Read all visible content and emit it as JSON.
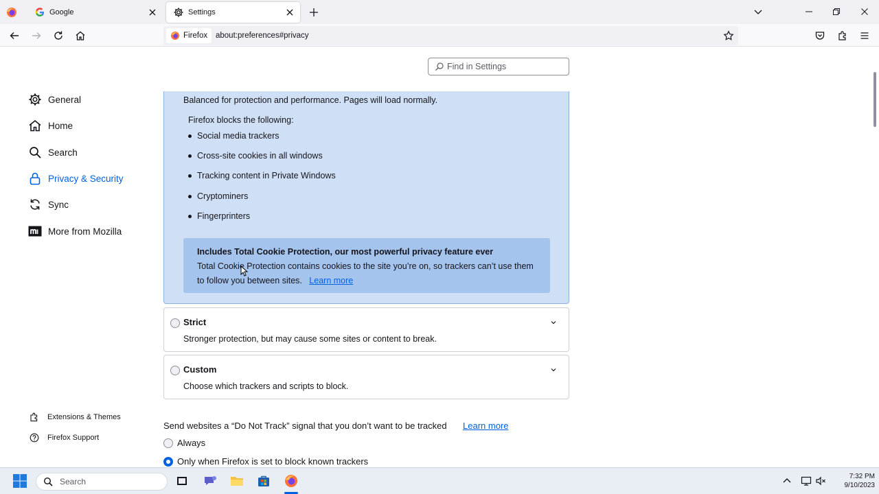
{
  "browser": {
    "tabs": [
      {
        "label": "Google",
        "favicon": "google-icon",
        "active": false
      },
      {
        "label": "Settings",
        "favicon": "gear-icon",
        "active": true
      }
    ],
    "identity_label": "Firefox",
    "url": "about:preferences#privacy"
  },
  "sidebar": {
    "categories": [
      {
        "label": "General",
        "icon": "gear-icon",
        "selected": false
      },
      {
        "label": "Home",
        "icon": "home-icon",
        "selected": false
      },
      {
        "label": "Search",
        "icon": "search-icon",
        "selected": false
      },
      {
        "label": "Privacy & Security",
        "icon": "lock-icon",
        "selected": true
      },
      {
        "label": "Sync",
        "icon": "sync-icon",
        "selected": false
      },
      {
        "label": "More from Mozilla",
        "icon": "mozilla-icon",
        "selected": false
      }
    ],
    "footer": [
      {
        "label": "Extensions & Themes",
        "icon": "puzzle-icon"
      },
      {
        "label": "Firefox Support",
        "icon": "help-icon"
      }
    ]
  },
  "search": {
    "placeholder": "Find in Settings"
  },
  "standard": {
    "description": "Balanced for protection and performance. Pages will load normally.",
    "blocks_heading": "Firefox blocks the following:",
    "blocks": [
      "Social media trackers",
      "Cross-site cookies in all windows",
      "Tracking content in Private Windows",
      "Cryptominers",
      "Fingerprinters"
    ],
    "tcp": {
      "title": "Includes Total Cookie Protection, our most powerful privacy feature ever",
      "body": "Total Cookie Protection contains cookies to the site you’re on, so trackers can’t use them to follow you between sites.",
      "link": "Learn more"
    }
  },
  "options": [
    {
      "title": "Strict",
      "description": "Stronger protection, but may cause some sites or content to break."
    },
    {
      "title": "Custom",
      "description": "Choose which trackers and scripts to block."
    }
  ],
  "dnt": {
    "label": "Send websites a “Do Not Track” signal that you don’t want to be tracked",
    "learn_more": "Learn more",
    "choices": [
      {
        "label": "Always",
        "selected": false
      },
      {
        "label": "Only when Firefox is set to block known trackers",
        "selected": true
      }
    ]
  },
  "taskbar": {
    "search_placeholder": "Search",
    "time": "7:32 PM",
    "date": "9/10/2023"
  },
  "colors": {
    "accent": "#0061e0",
    "selected_card_bg": "#cfdff5",
    "tcp_bg": "#a4c4ee"
  }
}
